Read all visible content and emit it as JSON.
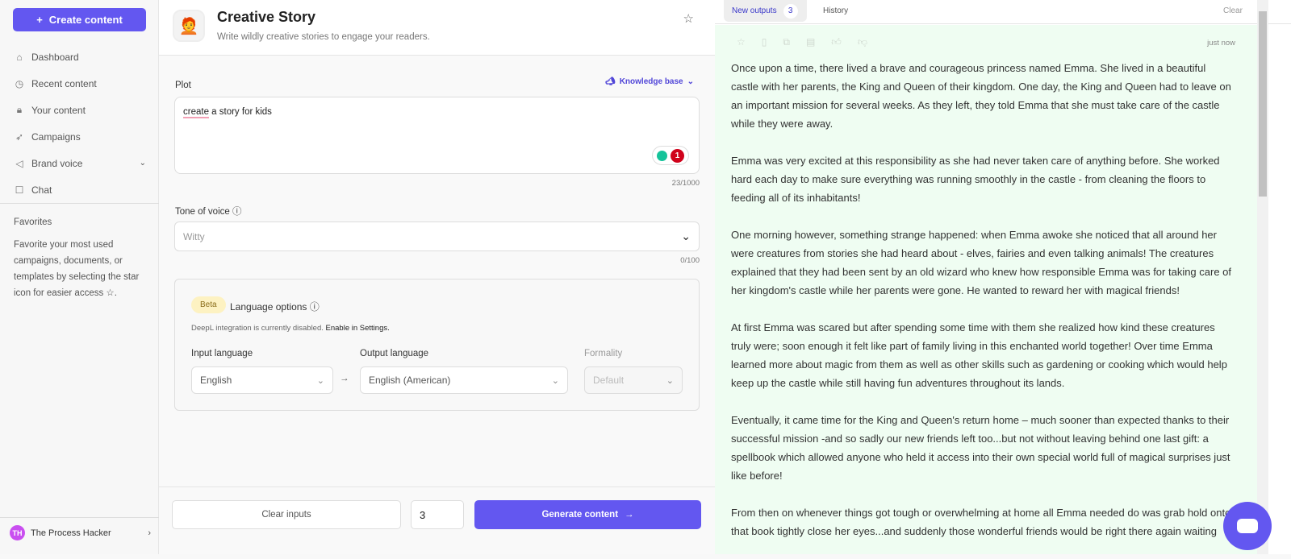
{
  "sidebar": {
    "create_label": "Create content",
    "items": [
      {
        "label": "Dashboard",
        "icon": "home-icon"
      },
      {
        "label": "Recent content",
        "icon": "clock-icon"
      },
      {
        "label": "Your content",
        "icon": "lock-icon"
      },
      {
        "label": "Campaigns",
        "icon": "rocket-icon"
      },
      {
        "label": "Brand voice",
        "icon": "megaphone-icon"
      },
      {
        "label": "Chat",
        "icon": "chat-icon"
      }
    ],
    "favorites_title": "Favorites",
    "favorites_text": "Favorite your most used campaigns, documents, or templates by selecting the star icon for easier access",
    "user": {
      "initials": "TH",
      "name": "The Process Hacker"
    }
  },
  "header": {
    "title": "Creative Story",
    "subtitle": "Write wildly creative stories to engage your readers."
  },
  "form": {
    "plot_label": "Plot",
    "knowledge_base": "Knowledge base",
    "plot_value_first": "create",
    "plot_value_rest": " a story for kids",
    "grammar_count": "1",
    "plot_count": "23/1000",
    "tone_label": "Tone of voice",
    "tone_placeholder": "Witty",
    "tone_count": "0/100",
    "language": {
      "beta": "Beta",
      "title": "Language options",
      "note": "DeepL integration is currently disabled.",
      "note_link": "Enable in Settings.",
      "input_label": "Input language",
      "input_value": "English",
      "output_label": "Output language",
      "output_value": "English (American)",
      "formality_label": "Formality",
      "formality_value": "Default"
    }
  },
  "footer": {
    "clear_label": "Clear inputs",
    "quantity": "3",
    "generate_label": "Generate content"
  },
  "outputs": {
    "tab_new": "New outputs",
    "tab_new_count": "3",
    "tab_history": "History",
    "clear": "Clear",
    "time": "just now",
    "paragraphs": [
      "Once upon a time, there lived a brave and courageous princess named Emma. She lived in a beautiful castle with her parents, the King and Queen of their kingdom. One day, the King and Queen had to leave on an important mission for several weeks. As they left, they told Emma that she must take care of the castle while they were away.",
      "Emma was very excited at this responsibility as she had never taken care of anything before. She worked hard each day to make sure everything was running smoothly in the castle - from cleaning the floors to feeding all of its inhabitants!",
      "One morning however, something strange happened: when Emma awoke she noticed that all around her were creatures from stories she had heard about - elves, fairies and even talking animals! The creatures explained that they had been sent by an old wizard who knew how responsible Emma was for taking care of her kingdom's castle while her parents were gone. He wanted to reward her with magical friends!",
      "At first Emma was scared but after spending some time with them she realized how kind these creatures truly were; soon enough it felt like part of family living in this enchanted world together! Over time Emma learned more about magic from them as well as other skills such as gardening or cooking which would help keep up the castle while still having fun adventures throughout its lands.",
      "Eventually, it came time for the King and Queen's return home – much sooner than expected thanks to their successful mission -and so sadly our new friends left too...but not without leaving behind one last gift: a spellbook which allowed anyone who held it access into their own special world full of magical surprises just like before!",
      "From then on whenever things got tough or overwhelming at home all Emma needed do was grab hold onto that book tightly close her eyes...and suddenly those wonderful friends would be right there again waiting"
    ]
  },
  "colors": {
    "accent": "#6357f0",
    "output_bg": "#effdf2"
  }
}
